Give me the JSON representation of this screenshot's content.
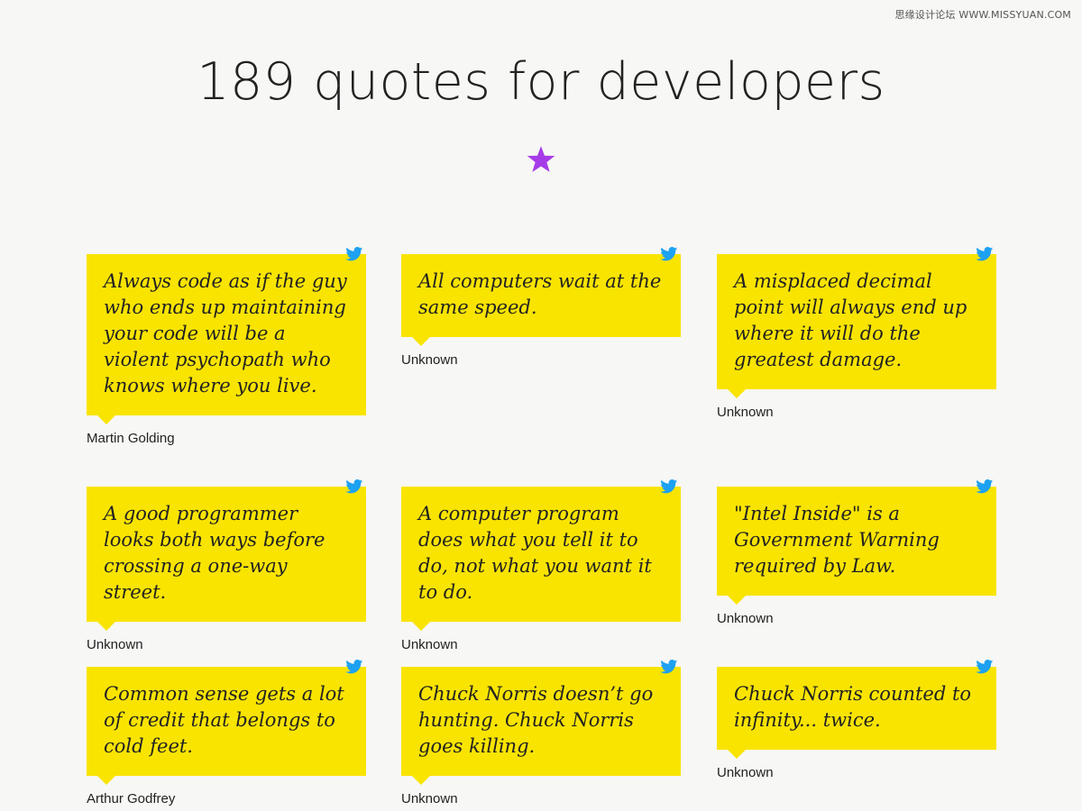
{
  "watermark": "思缘设计论坛 WWW.MISSYUAN.COM",
  "header": {
    "title": "189 quotes for developers",
    "star_icon": "star-icon",
    "star_color": "#a63be8"
  },
  "colors": {
    "background": "#f7f7f5",
    "card": "#f9e400",
    "twitter": "#1da1f2"
  },
  "quotes": [
    {
      "text": "Always code as if the guy who ends up maintaining your code will be a violent psychopath who knows where you live.",
      "author": "Martin Golding"
    },
    {
      "text": "All computers wait at the same speed.",
      "author": "Unknown"
    },
    {
      "text": "A misplaced decimal point will always end up where it will do the greatest damage.",
      "author": "Unknown"
    },
    {
      "text": "A good programmer looks both ways before crossing a one-way street.",
      "author": "Unknown"
    },
    {
      "text": "A computer program does what you tell it to do, not what you want it to do.",
      "author": "Unknown"
    },
    {
      "text": "\"Intel Inside\" is a Government Warning required by Law.",
      "author": "Unknown"
    },
    {
      "text": "Common sense gets a lot of credit that belongs to cold feet.",
      "author": "Arthur Godfrey"
    },
    {
      "text": "Chuck Norris doesn’t go hunting. Chuck Norris goes killing.",
      "author": "Unknown"
    },
    {
      "text": "Chuck Norris counted to infinity... twice.",
      "author": "Unknown"
    }
  ]
}
